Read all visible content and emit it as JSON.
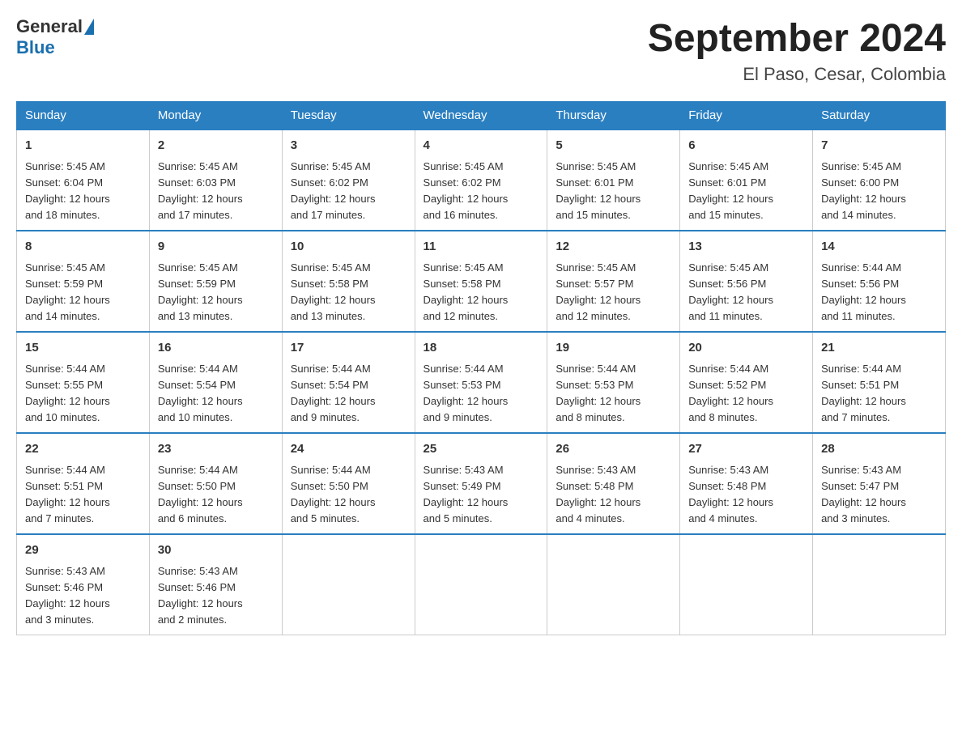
{
  "header": {
    "logo_general": "General",
    "logo_blue": "Blue",
    "title": "September 2024",
    "subtitle": "El Paso, Cesar, Colombia"
  },
  "days_of_week": [
    "Sunday",
    "Monday",
    "Tuesday",
    "Wednesday",
    "Thursday",
    "Friday",
    "Saturday"
  ],
  "weeks": [
    [
      {
        "day": "1",
        "sunrise": "5:45 AM",
        "sunset": "6:04 PM",
        "daylight": "12 hours and 18 minutes."
      },
      {
        "day": "2",
        "sunrise": "5:45 AM",
        "sunset": "6:03 PM",
        "daylight": "12 hours and 17 minutes."
      },
      {
        "day": "3",
        "sunrise": "5:45 AM",
        "sunset": "6:02 PM",
        "daylight": "12 hours and 17 minutes."
      },
      {
        "day": "4",
        "sunrise": "5:45 AM",
        "sunset": "6:02 PM",
        "daylight": "12 hours and 16 minutes."
      },
      {
        "day": "5",
        "sunrise": "5:45 AM",
        "sunset": "6:01 PM",
        "daylight": "12 hours and 15 minutes."
      },
      {
        "day": "6",
        "sunrise": "5:45 AM",
        "sunset": "6:01 PM",
        "daylight": "12 hours and 15 minutes."
      },
      {
        "day": "7",
        "sunrise": "5:45 AM",
        "sunset": "6:00 PM",
        "daylight": "12 hours and 14 minutes."
      }
    ],
    [
      {
        "day": "8",
        "sunrise": "5:45 AM",
        "sunset": "5:59 PM",
        "daylight": "12 hours and 14 minutes."
      },
      {
        "day": "9",
        "sunrise": "5:45 AM",
        "sunset": "5:59 PM",
        "daylight": "12 hours and 13 minutes."
      },
      {
        "day": "10",
        "sunrise": "5:45 AM",
        "sunset": "5:58 PM",
        "daylight": "12 hours and 13 minutes."
      },
      {
        "day": "11",
        "sunrise": "5:45 AM",
        "sunset": "5:58 PM",
        "daylight": "12 hours and 12 minutes."
      },
      {
        "day": "12",
        "sunrise": "5:45 AM",
        "sunset": "5:57 PM",
        "daylight": "12 hours and 12 minutes."
      },
      {
        "day": "13",
        "sunrise": "5:45 AM",
        "sunset": "5:56 PM",
        "daylight": "12 hours and 11 minutes."
      },
      {
        "day": "14",
        "sunrise": "5:44 AM",
        "sunset": "5:56 PM",
        "daylight": "12 hours and 11 minutes."
      }
    ],
    [
      {
        "day": "15",
        "sunrise": "5:44 AM",
        "sunset": "5:55 PM",
        "daylight": "12 hours and 10 minutes."
      },
      {
        "day": "16",
        "sunrise": "5:44 AM",
        "sunset": "5:54 PM",
        "daylight": "12 hours and 10 minutes."
      },
      {
        "day": "17",
        "sunrise": "5:44 AM",
        "sunset": "5:54 PM",
        "daylight": "12 hours and 9 minutes."
      },
      {
        "day": "18",
        "sunrise": "5:44 AM",
        "sunset": "5:53 PM",
        "daylight": "12 hours and 9 minutes."
      },
      {
        "day": "19",
        "sunrise": "5:44 AM",
        "sunset": "5:53 PM",
        "daylight": "12 hours and 8 minutes."
      },
      {
        "day": "20",
        "sunrise": "5:44 AM",
        "sunset": "5:52 PM",
        "daylight": "12 hours and 8 minutes."
      },
      {
        "day": "21",
        "sunrise": "5:44 AM",
        "sunset": "5:51 PM",
        "daylight": "12 hours and 7 minutes."
      }
    ],
    [
      {
        "day": "22",
        "sunrise": "5:44 AM",
        "sunset": "5:51 PM",
        "daylight": "12 hours and 7 minutes."
      },
      {
        "day": "23",
        "sunrise": "5:44 AM",
        "sunset": "5:50 PM",
        "daylight": "12 hours and 6 minutes."
      },
      {
        "day": "24",
        "sunrise": "5:44 AM",
        "sunset": "5:50 PM",
        "daylight": "12 hours and 5 minutes."
      },
      {
        "day": "25",
        "sunrise": "5:43 AM",
        "sunset": "5:49 PM",
        "daylight": "12 hours and 5 minutes."
      },
      {
        "day": "26",
        "sunrise": "5:43 AM",
        "sunset": "5:48 PM",
        "daylight": "12 hours and 4 minutes."
      },
      {
        "day": "27",
        "sunrise": "5:43 AM",
        "sunset": "5:48 PM",
        "daylight": "12 hours and 4 minutes."
      },
      {
        "day": "28",
        "sunrise": "5:43 AM",
        "sunset": "5:47 PM",
        "daylight": "12 hours and 3 minutes."
      }
    ],
    [
      {
        "day": "29",
        "sunrise": "5:43 AM",
        "sunset": "5:46 PM",
        "daylight": "12 hours and 3 minutes."
      },
      {
        "day": "30",
        "sunrise": "5:43 AM",
        "sunset": "5:46 PM",
        "daylight": "12 hours and 2 minutes."
      },
      null,
      null,
      null,
      null,
      null
    ]
  ],
  "labels": {
    "sunrise": "Sunrise:",
    "sunset": "Sunset:",
    "daylight": "Daylight:"
  }
}
